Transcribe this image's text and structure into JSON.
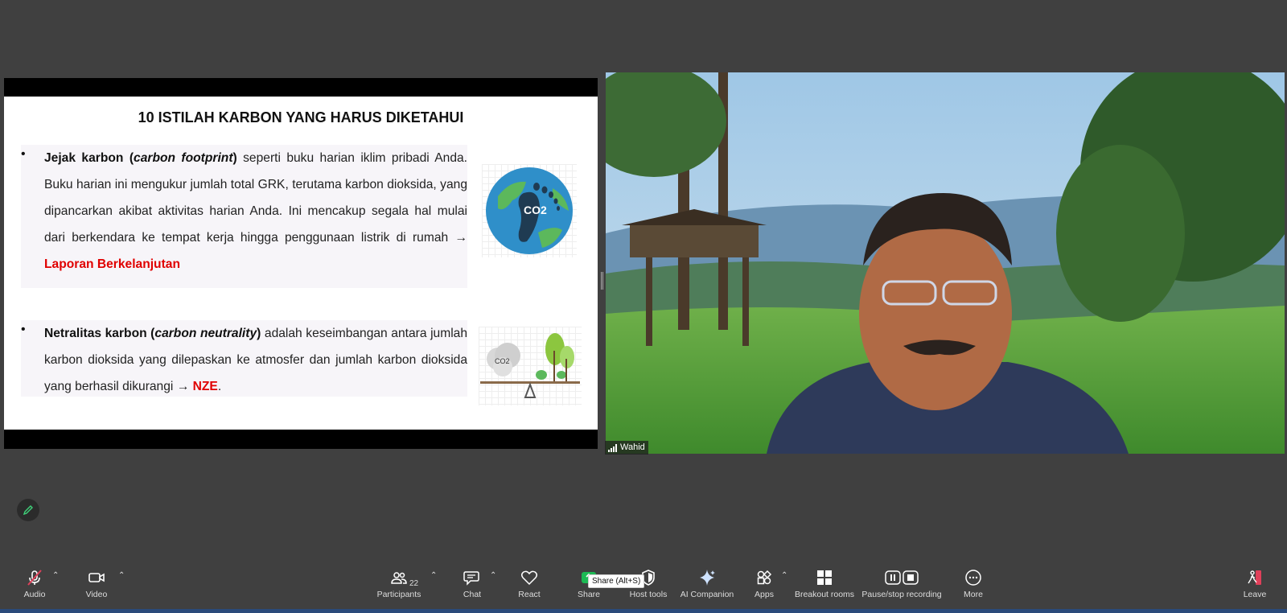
{
  "slide": {
    "title": "10 ISTILAH KARBON YANG HARUS DIKETAHUI",
    "bullet1": {
      "term": "Jejak karbon (",
      "term_italic": "carbon footprint",
      "term_close": ")",
      "text": " seperti buku harian iklim pribadi Anda. Buku harian ini mengukur jumlah total GRK, terutama karbon dioksida, yang dipancarkan akibat aktivitas harian Anda. Ini mencakup segala hal mulai dari berkendara ke tempat kerja hingga penggunaan listrik di rumah → ",
      "highlight": "Laporan Berkelanjutan"
    },
    "bullet2": {
      "term": "Netralitas karbon (",
      "term_italic": "carbon neutrality",
      "term_close": ")",
      "text": " adalah keseimbangan antara jumlah karbon dioksida yang dilepaskan ke atmosfer dan jumlah karbon dioksida yang berhasil dikurangi → ",
      "highlight": "NZE",
      "end": "."
    },
    "globe_label": "CO2",
    "seesaw_label": "CO2"
  },
  "video": {
    "participant_name": "Wahid"
  },
  "toolbar": {
    "audio": "Audio",
    "video": "Video",
    "participants": "Participants",
    "participants_count": "22",
    "chat": "Chat",
    "react": "React",
    "share": "Share",
    "share_tooltip": "Share (Alt+S)",
    "host_tools": "Host tools",
    "ai_companion": "AI Companion",
    "apps": "Apps",
    "breakout_rooms": "Breakout rooms",
    "recording": "Pause/stop recording",
    "more": "More",
    "leave": "Leave"
  },
  "colors": {
    "accent_red": "#e00000",
    "share_green": "#1db954",
    "bg": "#404040"
  }
}
